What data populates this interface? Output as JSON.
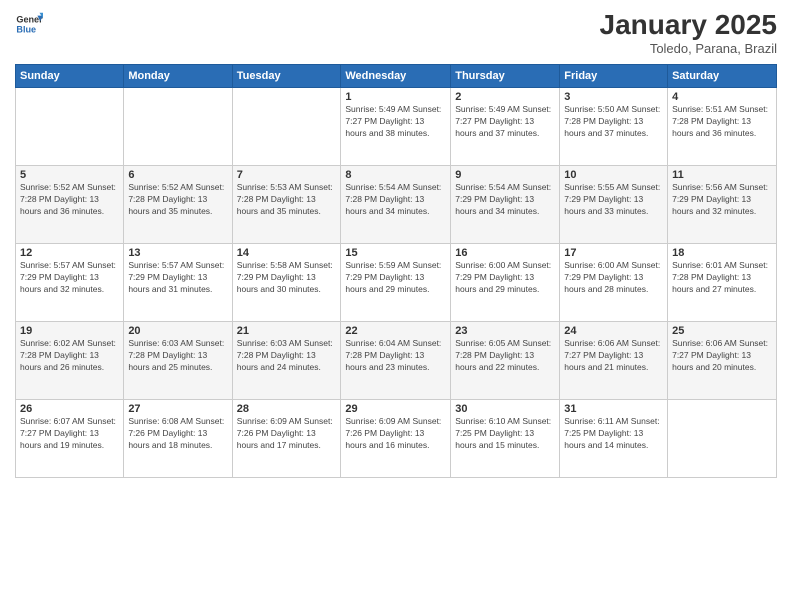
{
  "logo": {
    "line1": "General",
    "line2": "Blue"
  },
  "title": "January 2025",
  "subtitle": "Toledo, Parana, Brazil",
  "days_of_week": [
    "Sunday",
    "Monday",
    "Tuesday",
    "Wednesday",
    "Thursday",
    "Friday",
    "Saturday"
  ],
  "weeks": [
    [
      {
        "day": "",
        "info": ""
      },
      {
        "day": "",
        "info": ""
      },
      {
        "day": "",
        "info": ""
      },
      {
        "day": "1",
        "info": "Sunrise: 5:49 AM\nSunset: 7:27 PM\nDaylight: 13 hours\nand 38 minutes."
      },
      {
        "day": "2",
        "info": "Sunrise: 5:49 AM\nSunset: 7:27 PM\nDaylight: 13 hours\nand 37 minutes."
      },
      {
        "day": "3",
        "info": "Sunrise: 5:50 AM\nSunset: 7:28 PM\nDaylight: 13 hours\nand 37 minutes."
      },
      {
        "day": "4",
        "info": "Sunrise: 5:51 AM\nSunset: 7:28 PM\nDaylight: 13 hours\nand 36 minutes."
      }
    ],
    [
      {
        "day": "5",
        "info": "Sunrise: 5:52 AM\nSunset: 7:28 PM\nDaylight: 13 hours\nand 36 minutes."
      },
      {
        "day": "6",
        "info": "Sunrise: 5:52 AM\nSunset: 7:28 PM\nDaylight: 13 hours\nand 35 minutes."
      },
      {
        "day": "7",
        "info": "Sunrise: 5:53 AM\nSunset: 7:28 PM\nDaylight: 13 hours\nand 35 minutes."
      },
      {
        "day": "8",
        "info": "Sunrise: 5:54 AM\nSunset: 7:28 PM\nDaylight: 13 hours\nand 34 minutes."
      },
      {
        "day": "9",
        "info": "Sunrise: 5:54 AM\nSunset: 7:29 PM\nDaylight: 13 hours\nand 34 minutes."
      },
      {
        "day": "10",
        "info": "Sunrise: 5:55 AM\nSunset: 7:29 PM\nDaylight: 13 hours\nand 33 minutes."
      },
      {
        "day": "11",
        "info": "Sunrise: 5:56 AM\nSunset: 7:29 PM\nDaylight: 13 hours\nand 32 minutes."
      }
    ],
    [
      {
        "day": "12",
        "info": "Sunrise: 5:57 AM\nSunset: 7:29 PM\nDaylight: 13 hours\nand 32 minutes."
      },
      {
        "day": "13",
        "info": "Sunrise: 5:57 AM\nSunset: 7:29 PM\nDaylight: 13 hours\nand 31 minutes."
      },
      {
        "day": "14",
        "info": "Sunrise: 5:58 AM\nSunset: 7:29 PM\nDaylight: 13 hours\nand 30 minutes."
      },
      {
        "day": "15",
        "info": "Sunrise: 5:59 AM\nSunset: 7:29 PM\nDaylight: 13 hours\nand 29 minutes."
      },
      {
        "day": "16",
        "info": "Sunrise: 6:00 AM\nSunset: 7:29 PM\nDaylight: 13 hours\nand 29 minutes."
      },
      {
        "day": "17",
        "info": "Sunrise: 6:00 AM\nSunset: 7:29 PM\nDaylight: 13 hours\nand 28 minutes."
      },
      {
        "day": "18",
        "info": "Sunrise: 6:01 AM\nSunset: 7:28 PM\nDaylight: 13 hours\nand 27 minutes."
      }
    ],
    [
      {
        "day": "19",
        "info": "Sunrise: 6:02 AM\nSunset: 7:28 PM\nDaylight: 13 hours\nand 26 minutes."
      },
      {
        "day": "20",
        "info": "Sunrise: 6:03 AM\nSunset: 7:28 PM\nDaylight: 13 hours\nand 25 minutes."
      },
      {
        "day": "21",
        "info": "Sunrise: 6:03 AM\nSunset: 7:28 PM\nDaylight: 13 hours\nand 24 minutes."
      },
      {
        "day": "22",
        "info": "Sunrise: 6:04 AM\nSunset: 7:28 PM\nDaylight: 13 hours\nand 23 minutes."
      },
      {
        "day": "23",
        "info": "Sunrise: 6:05 AM\nSunset: 7:28 PM\nDaylight: 13 hours\nand 22 minutes."
      },
      {
        "day": "24",
        "info": "Sunrise: 6:06 AM\nSunset: 7:27 PM\nDaylight: 13 hours\nand 21 minutes."
      },
      {
        "day": "25",
        "info": "Sunrise: 6:06 AM\nSunset: 7:27 PM\nDaylight: 13 hours\nand 20 minutes."
      }
    ],
    [
      {
        "day": "26",
        "info": "Sunrise: 6:07 AM\nSunset: 7:27 PM\nDaylight: 13 hours\nand 19 minutes."
      },
      {
        "day": "27",
        "info": "Sunrise: 6:08 AM\nSunset: 7:26 PM\nDaylight: 13 hours\nand 18 minutes."
      },
      {
        "day": "28",
        "info": "Sunrise: 6:09 AM\nSunset: 7:26 PM\nDaylight: 13 hours\nand 17 minutes."
      },
      {
        "day": "29",
        "info": "Sunrise: 6:09 AM\nSunset: 7:26 PM\nDaylight: 13 hours\nand 16 minutes."
      },
      {
        "day": "30",
        "info": "Sunrise: 6:10 AM\nSunset: 7:25 PM\nDaylight: 13 hours\nand 15 minutes."
      },
      {
        "day": "31",
        "info": "Sunrise: 6:11 AM\nSunset: 7:25 PM\nDaylight: 13 hours\nand 14 minutes."
      },
      {
        "day": "",
        "info": ""
      }
    ]
  ]
}
